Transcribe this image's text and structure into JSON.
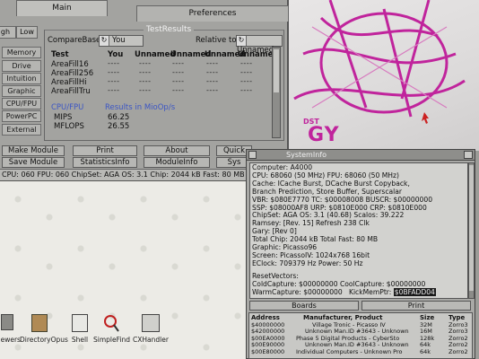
{
  "main_window": {
    "tabs": {
      "main": "Main",
      "preferences": "Preferences"
    },
    "side_tabs": {
      "high": "gh",
      "low": "Low"
    },
    "sidebar": [
      "Memory",
      "Drive",
      "Intuition",
      "Graphic",
      "CPU/FPU",
      "PowerPC",
      "External"
    ],
    "group_title": "TestResults",
    "compare_base_label": "CompareBase",
    "compare_base_value": "You",
    "relative_to_label": "Relative to",
    "relative_to_value": "Unnamed",
    "columns": [
      "Test",
      "You",
      "Unnamed",
      "Unnamed",
      "Unnamed",
      "Unnamed"
    ],
    "tests": [
      {
        "name": "AreaFill16"
      },
      {
        "name": "AreaFill256"
      },
      {
        "name": "AreaFillHi"
      },
      {
        "name": "AreaFillTru"
      }
    ],
    "dashes": "----",
    "cpu_section": {
      "heading": "CPU/FPU",
      "results_label": "Results  in MioOp/s"
    },
    "cpu_rows": [
      {
        "name": "MIPS",
        "value": "66.25"
      },
      {
        "name": "MFLOPS",
        "value": "26.55"
      }
    ],
    "buttons_row1": [
      "Make Module",
      "Print",
      "About",
      "Quick"
    ],
    "buttons_row2": [
      "Save Module",
      "StatisticsInfo",
      "ModuleInfo",
      "Sys"
    ],
    "status": "CPU: 060  FPU: 060  ChipSet: AGA   OS: 3.1   Chip: 2044 kB   Fast: 80 MB"
  },
  "wallpaper": {
    "small_text": "DST",
    "big_text": "GY"
  },
  "info_window": {
    "title": "SystemInfo",
    "lines": [
      "Computer: A4000",
      "CPU: 68060 (50 MHz)    FPU: 68060 (50 MHz)",
      "Cache: ICache Burst, DCache Burst Copyback,",
      "  Branch Prediction, Store Buffer, Superscalar",
      "VBR: $080E7770   TC: $00008008   BUSCR: $00000000",
      "SSP: $08000AF8   URP: $0810E000   CRP: $0810E000",
      "ChipSet: AGA    OS: 3.1 (40.68)   Scalos: 39.222",
      "Ramsey: [Rev. 15] Refresh 238 Clk",
      "Gary: [Rev 0]",
      "Total Chip: 2044 kB    Total Fast: 80 MB",
      "Graphic: Picasso96",
      "Screen: PicassoIV: 1024x768 16bit",
      "EClock: 709379 Hz    Power: 50 Hz",
      "",
      "ResetVectors:",
      "ColdCapture: $00000000    CoolCapture: $00000000",
      "WarmCapture: $00000000"
    ],
    "kickmem_label": "KickMemPtr:",
    "kickmem_value": "$0BFADD04",
    "btn_boards": "Boards",
    "btn_print": "Print",
    "boards_headers": [
      "Address",
      "Manufacturer, Product",
      "Size",
      "Type"
    ],
    "boards": [
      {
        "addr": "$40000000",
        "prod": "Village Tronic - Picasso IV",
        "size": "32M",
        "type": "Zorro3"
      },
      {
        "addr": "$42000000",
        "prod": "Unknown Man.ID #3643 - Unknown",
        "size": "16M",
        "type": "Zorro3"
      },
      {
        "addr": "$00EA0000",
        "prod": "Phase 5 Digital Products - CyberSto",
        "size": "128k",
        "type": "Zorro2"
      },
      {
        "addr": "$00E90000",
        "prod": "Unknown Man.ID #3643 - Unknown",
        "size": "64k",
        "type": "Zorro2"
      },
      {
        "addr": "$00E80000",
        "prod": "Individual Computers - Unknown Pro",
        "size": "64k",
        "type": "Zorro2"
      }
    ]
  },
  "desktop_icons": [
    "aewers",
    "DirectoryOpus",
    "Shell",
    "SimpleFind",
    "CXHandler"
  ]
}
